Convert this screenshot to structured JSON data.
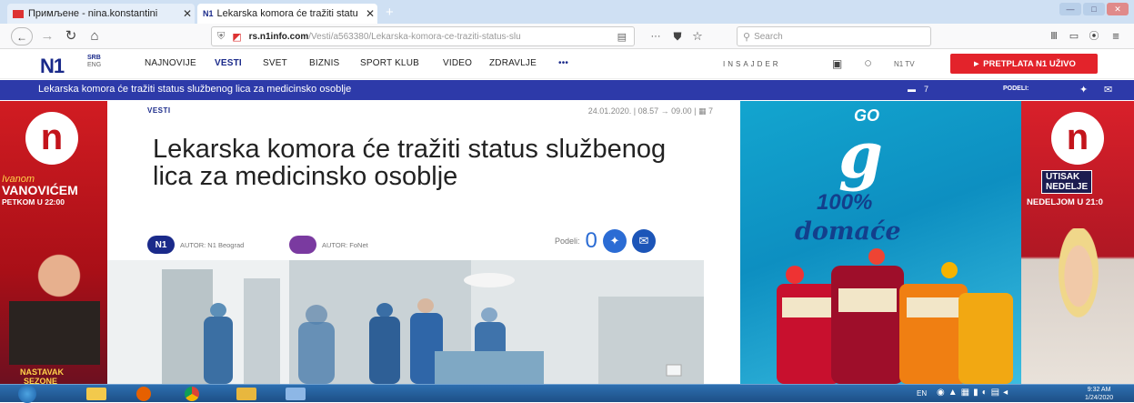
{
  "browser": {
    "tabs": [
      {
        "label": "Примљене - nina.konstantini",
        "active": false
      },
      {
        "label": "Lekarska komora će tražiti statu",
        "active": true
      }
    ],
    "url": "rs.n1info.com/Vesti/a563380/Lekarska-komora-ce-traziti-status-slu",
    "url_domain": "rs.n1info.com",
    "url_path": "/Vesti/a563380/Lekarska-komora-ce-traziti-status-slu",
    "search_placeholder": "Search",
    "page_actions": "···"
  },
  "site": {
    "logo": "N1",
    "edition": "SRB",
    "edition_sub": "ENG",
    "menu": [
      "NAJNOVIJE",
      "VESTI",
      "SVET",
      "BIZNIS",
      "SPORT KLUB",
      "VIDEO",
      "ZDRAVLJE",
      "•••"
    ],
    "insajder": "INSAJDER",
    "n1tv": "N1 TV",
    "cta": "► PRETPLATA N1 UŽIVO",
    "bluebar_title": "Lekarska komora će tražiti status službenog lica za medicinsko osoblje",
    "comments": "7",
    "podeli_label": "PODELI:"
  },
  "article": {
    "section": "VESTI",
    "meta": "24.01.2020. | 08.57 → 09.00 | ▦ 7",
    "headline": "Lekarska komora će tražiti status službenog lica za medicinsko osoblje",
    "author1": "AUTOR: N1 Beograd",
    "author1_badge": "N1",
    "author2": "AUTOR: FoNet",
    "share_label": "Podeli:",
    "share_count": "0"
  },
  "ads": {
    "left": {
      "line1": "Ivanom",
      "line2": "VANOVIĆEM",
      "line3": "PETKOM U 22:00",
      "line4": "NASTAVAK",
      "line5": "SEZONE"
    },
    "middle": {
      "line1": "GO",
      "line2": "100%",
      "line3": "domaće"
    },
    "right": {
      "line1": "UTISAK",
      "line2": "NEDELJE",
      "line3": "NEDELJOM U 21:0"
    }
  },
  "taskbar": {
    "lang": "EN",
    "time": "9:32 AM",
    "date": "1/24/2020"
  }
}
